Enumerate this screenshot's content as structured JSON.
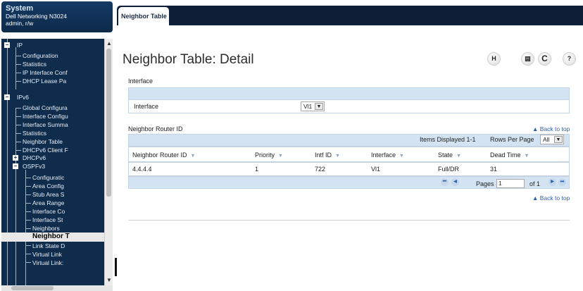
{
  "system": {
    "title": "System",
    "device": "Dell Networking N3024",
    "user": "admin, r/w"
  },
  "nav": {
    "items": [
      {
        "label": "IP",
        "selected": false
      },
      {
        "label": "Configuration",
        "selected": false
      },
      {
        "label": "Statistics",
        "selected": false
      },
      {
        "label": "IP Interface Conf",
        "selected": false
      },
      {
        "label": "DHCP Lease Pa",
        "selected": false
      },
      {
        "label": "IPv6",
        "selected": false
      },
      {
        "label": "Global Configura",
        "selected": false
      },
      {
        "label": "Interface Configu",
        "selected": false
      },
      {
        "label": "Interface Summa",
        "selected": false
      },
      {
        "label": "Statistics",
        "selected": false
      },
      {
        "label": "Neighbor Table",
        "selected": false
      },
      {
        "label": "DHCPv6 Client F",
        "selected": false
      },
      {
        "label": "DHCPv6",
        "selected": false
      },
      {
        "label": "OSPFv3",
        "selected": false
      },
      {
        "label": "Configuratic",
        "selected": false
      },
      {
        "label": "Area Config",
        "selected": false
      },
      {
        "label": "Stub Area S",
        "selected": false
      },
      {
        "label": "Area Range",
        "selected": false
      },
      {
        "label": "Interface Co",
        "selected": false
      },
      {
        "label": "Interface St",
        "selected": false
      },
      {
        "label": "Neighbors",
        "selected": false
      },
      {
        "label": "Neighbor T",
        "selected": true
      },
      {
        "label": "Link State D",
        "selected": false
      },
      {
        "label": "Virtual Link",
        "selected": false
      },
      {
        "label": "Virtual Link:",
        "selected": false
      }
    ]
  },
  "tab": {
    "label": "Neighbor Table"
  },
  "page": {
    "title": "Neighbor Table: Detail"
  },
  "toolbar": {
    "save_icon": "floppy-disk-icon",
    "print_icon": "printer-icon",
    "refresh_icon": "refresh-icon",
    "help_icon": "help-icon"
  },
  "interface_section": {
    "heading": "Interface",
    "field_label": "Interface",
    "field_value": "Vl1"
  },
  "neighbor_section": {
    "heading": "Neighbor Router ID",
    "back_to_top": "▲ Back to top",
    "items_displayed": "Items Displayed 1-1",
    "rows_per_page_label": "Rows Per Page",
    "rows_per_page_value": "All",
    "columns": [
      "Neighbor Router ID",
      "Priority",
      "Intf ID",
      "Interface",
      "State",
      "Dead Time"
    ],
    "rows": [
      [
        "4.4.4.4",
        "1",
        "722",
        "Vl1",
        "Full/DR",
        "31"
      ]
    ],
    "pages_label": "Pages",
    "page_value": "1",
    "page_total": "of 1",
    "back_to_top_bottom": "▲ Back to top"
  },
  "colors": {
    "nav_bg": "#0f2c4d",
    "tabbar_bg": "#0c1f36",
    "section_header": "#d3e3f2",
    "link": "#2f5fa5"
  }
}
